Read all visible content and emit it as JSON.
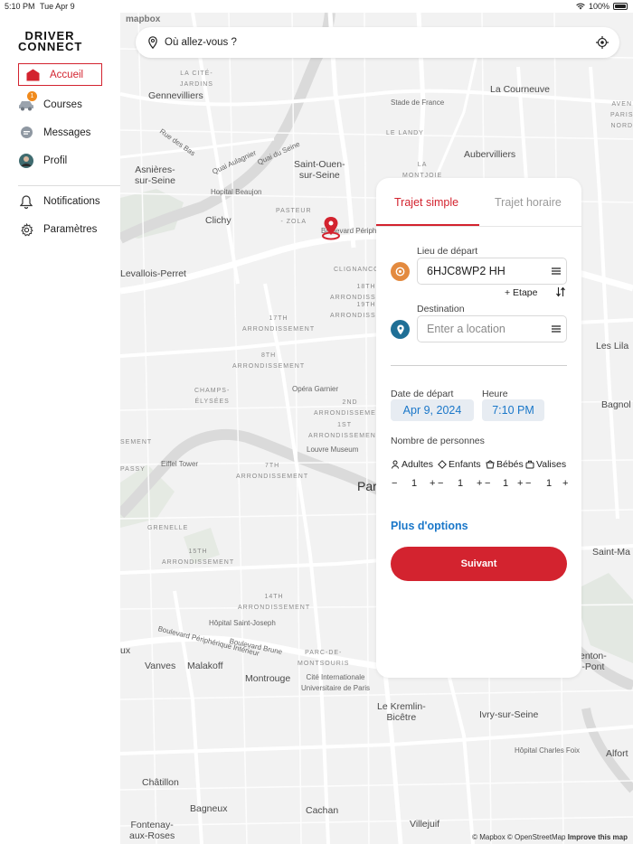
{
  "status_bar": {
    "time": "5:10 PM",
    "date": "Tue Apr 9",
    "battery": "100%"
  },
  "sidebar": {
    "logo_top": "DRIVER",
    "logo_bottom": "CONNECT",
    "items": [
      {
        "label": "Accueil",
        "icon": "home-icon",
        "active": true
      },
      {
        "label": "Courses",
        "icon": "car-icon",
        "badge": "1"
      },
      {
        "label": "Messages",
        "icon": "chat-icon"
      },
      {
        "label": "Profil",
        "icon": "avatar"
      },
      {
        "label": "Notifications",
        "icon": "bell-icon"
      },
      {
        "label": "Paramètres",
        "icon": "gear-icon"
      }
    ]
  },
  "map": {
    "brand": "mapbox",
    "attribution_left": "© Mapbox © OpenStreetMap",
    "attribution_right": "Improve this map",
    "labels": [
      {
        "text": "Gennevilliers",
        "cls": ""
      },
      {
        "text": "La Courneuve",
        "cls": ""
      },
      {
        "text": "LA CITÉ-\nJARDINS",
        "cls": "small"
      },
      {
        "text": "Stade de France",
        "cls": "med"
      },
      {
        "text": "Rue des Bas",
        "cls": "med"
      },
      {
        "text": "LE LANDY",
        "cls": "small"
      },
      {
        "text": "Asnières-\nsur-Seine",
        "cls": ""
      },
      {
        "text": "Quai Aulagnier",
        "cls": "med"
      },
      {
        "text": "Quai du Seine",
        "cls": "med"
      },
      {
        "text": "Saint-Ouen-\nsur-Seine",
        "cls": ""
      },
      {
        "text": "Aubervilliers",
        "cls": ""
      },
      {
        "text": "LA\nMONTJOIE",
        "cls": "small"
      },
      {
        "text": "Hopital Beaujon",
        "cls": "med"
      },
      {
        "text": "Clichy",
        "cls": ""
      },
      {
        "text": "PASTEUR\n- ZOLA",
        "cls": "small"
      },
      {
        "text": "Boulevard Périphé",
        "cls": "med"
      },
      {
        "text": "Levallois-Perret",
        "cls": ""
      },
      {
        "text": "CLIGNANCO",
        "cls": "small"
      },
      {
        "text": "18TH\nARRONDISSEMENT",
        "cls": "small"
      },
      {
        "text": "17TH\nARRONDISSEMENT",
        "cls": "small"
      },
      {
        "text": "19TH\nARRONDISSEMENT",
        "cls": "small"
      },
      {
        "text": "8TH\nARRONDISSEMENT",
        "cls": "small"
      },
      {
        "text": "CHAMPS-\nÉLYSÉES",
        "cls": "small"
      },
      {
        "text": "Opéra Garnier",
        "cls": "med"
      },
      {
        "text": "2ND\nARRONDISSEMENT",
        "cls": "small"
      },
      {
        "text": "1ST\nARRONDISSEMENT",
        "cls": "small"
      },
      {
        "text": "SEMENT",
        "cls": "small"
      },
      {
        "text": "Louvre Museum",
        "cls": "med"
      },
      {
        "text": "Eiffel Tower",
        "cls": "med"
      },
      {
        "text": "PASSY",
        "cls": "small"
      },
      {
        "text": "7TH\nARRONDISSEMENT",
        "cls": "small"
      },
      {
        "text": "Par",
        "cls": ""
      },
      {
        "text": "GRENELLE",
        "cls": "small"
      },
      {
        "text": "15TH\nARRONDISSEMENT",
        "cls": "small"
      },
      {
        "text": "14TH\nARRONDISSEMENT",
        "cls": "small"
      },
      {
        "text": "Hôpital Saint-Joseph",
        "cls": "med"
      },
      {
        "text": "Boulevard Périphérique Intérieur",
        "cls": "med"
      },
      {
        "text": "Boulevard Brune",
        "cls": "med"
      },
      {
        "text": "PARC-DE-\nMONTSOURIS",
        "cls": "small"
      },
      {
        "text": "ux",
        "cls": ""
      },
      {
        "text": "Vanves",
        "cls": ""
      },
      {
        "text": "Malakoff",
        "cls": ""
      },
      {
        "text": "Montrouge",
        "cls": ""
      },
      {
        "text": "Cité Internationale\nUniversitaire de Paris",
        "cls": "med"
      },
      {
        "text": "Le Kremlin-\nBicêtre",
        "cls": ""
      },
      {
        "text": "Ivry-sur-Seine",
        "cls": ""
      },
      {
        "text": "Hôpital Charles Foix",
        "cls": "med"
      },
      {
        "text": "Alfort",
        "cls": ""
      },
      {
        "text": "Châtillon",
        "cls": ""
      },
      {
        "text": "Bagneux",
        "cls": ""
      },
      {
        "text": "Cachan",
        "cls": ""
      },
      {
        "text": "Fontenay-\naux-Roses",
        "cls": ""
      },
      {
        "text": "Villejuif",
        "cls": ""
      },
      {
        "text": "Les Lila",
        "cls": ""
      },
      {
        "text": "Bagnol",
        "cls": ""
      },
      {
        "text": "Saint-Ma",
        "cls": ""
      },
      {
        "text": "enton-\n-Pont",
        "cls": ""
      },
      {
        "text": "AVEN\nPARIS\nNORD",
        "cls": "small"
      }
    ]
  },
  "search": {
    "placeholder": "Où allez-vous ?"
  },
  "panel": {
    "tab_simple": "Trajet simple",
    "tab_hourly": "Trajet horaire",
    "departure_label": "Lieu de départ",
    "departure_value": "6HJC8WP2 HH",
    "etape_label": "+ Etape",
    "destination_label": "Destination",
    "destination_placeholder": "Enter a location",
    "date_label": "Date de départ",
    "date_value": "Apr 9, 2024",
    "time_label": "Heure",
    "time_value": "7:10 PM",
    "persons_label": "Nombre de personnes",
    "counters": [
      {
        "label": "Adultes",
        "value": "1"
      },
      {
        "label": "Enfants",
        "value": "1"
      },
      {
        "label": "Bébés",
        "value": "1"
      },
      {
        "label": "Valises",
        "value": "1"
      }
    ],
    "minus": "−",
    "plus": "+",
    "more_options": "Plus d'options",
    "next_button": "Suivant"
  },
  "colors": {
    "brand_red": "#d3232f",
    "link_blue": "#1a77c9",
    "orange": "#e38a3f",
    "teal": "#1f6f96"
  }
}
